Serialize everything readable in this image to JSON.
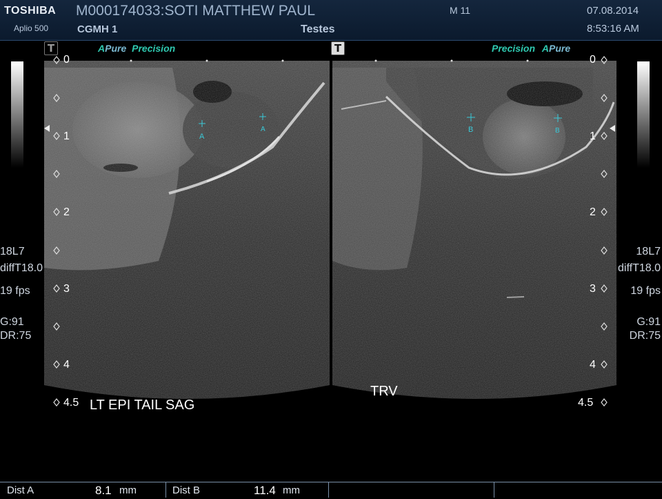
{
  "header": {
    "brand": "TOSHIBA",
    "model": "Aplio 500",
    "patient": "M000174033:SOTI MATTHEW PAUL",
    "institution": "CGMH 1",
    "exam": "Testes",
    "mode": "M 11",
    "date": "07.08.2014",
    "time": "8:53:16 AM"
  },
  "left_panel": {
    "tag": "T",
    "preset_a": "A",
    "preset_pure": "Pure",
    "preset_precision": "Precision",
    "annotation": "LT EPI TAIL SAG",
    "caliper_label": "A",
    "depth_labels": [
      "0",
      "1",
      "2",
      "3",
      "4",
      "4.5"
    ],
    "info": {
      "probe": "18L7",
      "freq": "diffT18.0",
      "fps": "19 fps",
      "gain": "G:91",
      "dr": "DR:75"
    }
  },
  "right_panel": {
    "tag": "T",
    "preset_precision": "Precision",
    "preset_a": "A",
    "preset_pure": "Pure",
    "annotation": "TRV",
    "caliper_label": "B",
    "depth_labels": [
      "0",
      "1",
      "2",
      "3",
      "4",
      "4.5"
    ],
    "info": {
      "probe": "18L7",
      "freq": "diffT18.0",
      "fps": "19 fps",
      "gain": "G:91",
      "dr": "DR:75"
    }
  },
  "measurements": [
    {
      "label": "Dist  A",
      "value": "8.1",
      "unit": "mm"
    },
    {
      "label": "Dist  B",
      "value": "11.4",
      "unit": "mm"
    }
  ],
  "colors": {
    "header_bg": "#0b1a2d",
    "caliper": "#39c9d8",
    "preset_accent": "#2fc9b0"
  }
}
